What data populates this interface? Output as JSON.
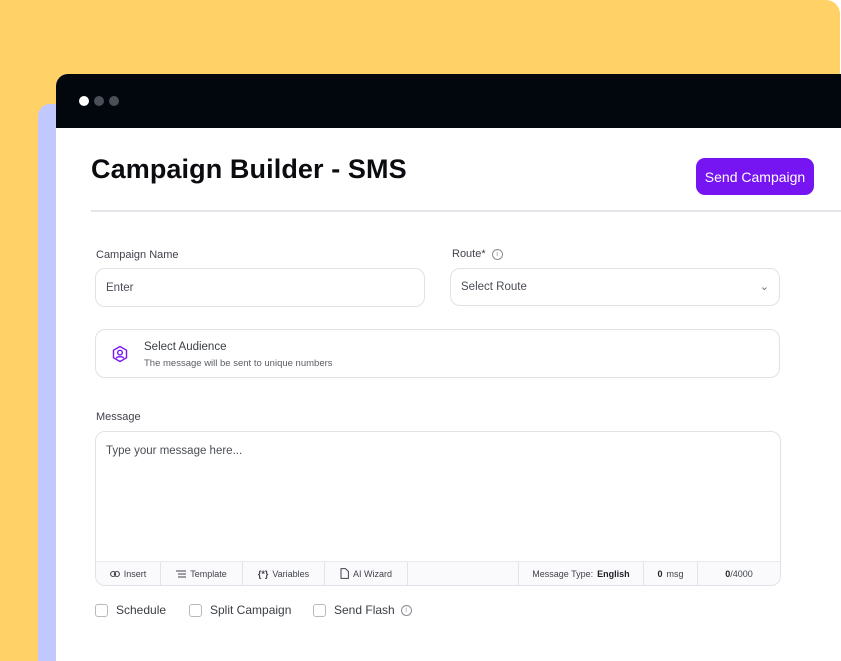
{
  "page": {
    "title": "Campaign Builder - SMS",
    "send_button": "Send Campaign"
  },
  "form": {
    "campaign_name_label": "Campaign Name",
    "campaign_name_placeholder": "Enter",
    "route_label": "Route*",
    "route_placeholder": "Select Route",
    "audience_title": "Select Audience",
    "audience_subtitle": "The message will be sent to unique numbers",
    "message_label": "Message",
    "message_placeholder": "Type your message here..."
  },
  "toolbar": {
    "insert": "Insert",
    "template": "Template",
    "variables": "Variables",
    "ai_wizard": "AI Wizard",
    "message_type_label": "Message Type:",
    "message_type_value": "English",
    "msg_count": "0",
    "msg_unit": "msg",
    "char_count": "0",
    "char_limit": "/4000"
  },
  "options": {
    "schedule": "Schedule",
    "split_campaign": "Split Campaign",
    "send_flash": "Send Flash"
  },
  "colors": {
    "accent": "#7714f2",
    "background_yellow": "#ffd166",
    "background_lilac": "#c1c8fd",
    "titlebar": "#02060d"
  }
}
